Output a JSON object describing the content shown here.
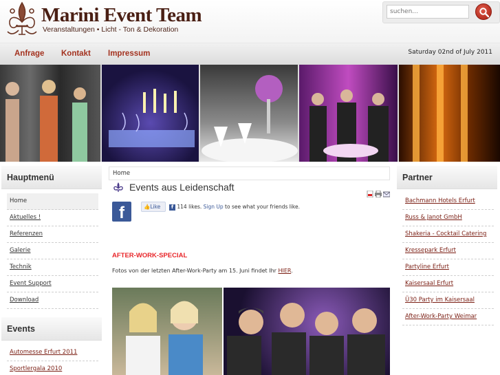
{
  "header": {
    "title": "Marini Event Team",
    "subtitle": "Veranstaltungen • Licht - Ton & Dekoration"
  },
  "search": {
    "placeholder": "suchen..."
  },
  "nav": {
    "items": [
      "Anfrage",
      "Kontakt",
      "Impressum"
    ],
    "date": "Saturday 02nd of July 2011"
  },
  "hauptmenu": {
    "title": "Hauptmenü",
    "items": [
      "Home",
      "Aktuelles !",
      "Referenzen",
      "Galerie",
      "Technik",
      "Event Support",
      "Download"
    ]
  },
  "events": {
    "title": "Events",
    "items": [
      "Automesse Erfurt 2011",
      "Sportlergala 2010"
    ]
  },
  "partner": {
    "title": "Partner",
    "items": [
      "Bachmann Hotels Erfurt",
      "Russ & Janot GmbH",
      "Shakeria - Cocktail Catering",
      "Kressepark Erfurt",
      "Partyline Erfurt",
      "Kaisersaal Erfurt",
      "Ü30 Party im Kaisersaal",
      "After-Work-Party Weimar"
    ]
  },
  "breadcrumb": "Home",
  "article": {
    "title": "Events aus Leidenschaft",
    "fb_like_label": "Like",
    "fb_likes_count": "114 likes.",
    "fb_signup": "Sign Up",
    "fb_suffix": "to see what your friends like.",
    "section_heading": "AFTER-WORK-SPECIAL",
    "section_text": "Fotos von der letzten After-Work-Party am 15. Juni findet Ihr",
    "section_link": "HIER",
    "section_end": "."
  },
  "colors": {
    "accent": "#a3321f",
    "link": "#7a1d12",
    "heading_red": "#e8262a",
    "logo_brown": "#4a1f14"
  }
}
